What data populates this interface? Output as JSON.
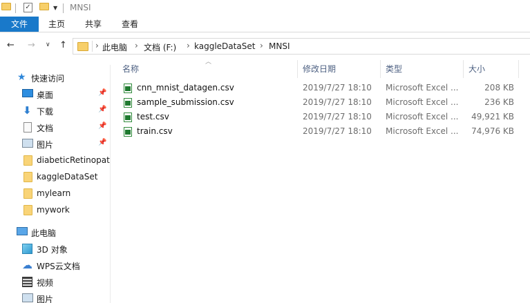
{
  "window": {
    "title": "MNSI"
  },
  "ribbon": {
    "tabs": [
      "文件",
      "主页",
      "共享",
      "查看"
    ]
  },
  "address": {
    "breadcrumb": [
      "此电脑",
      "文档 (F:)",
      "kaggleDataSet",
      "MNSI"
    ]
  },
  "sidebar": {
    "quick_access": "快速访问",
    "pinned": [
      "桌面",
      "下载",
      "文档",
      "图片"
    ],
    "folders": [
      "diabeticRetinopat",
      "kaggleDataSet",
      "mylearn",
      "mywork"
    ],
    "this_pc": "此电脑",
    "pc_items": [
      "3D 对象",
      "WPS云文档",
      "视频",
      "图片"
    ]
  },
  "columns": {
    "name": "名称",
    "date": "修改日期",
    "type": "类型",
    "size": "大小"
  },
  "files": [
    {
      "name": "cnn_mnist_datagen.csv",
      "date": "2019/7/27 18:10",
      "type": "Microsoft Excel ...",
      "size": "208 KB"
    },
    {
      "name": "sample_submission.csv",
      "date": "2019/7/27 18:10",
      "type": "Microsoft Excel ...",
      "size": "236 KB"
    },
    {
      "name": "test.csv",
      "date": "2019/7/27 18:10",
      "type": "Microsoft Excel ...",
      "size": "49,921 KB"
    },
    {
      "name": "train.csv",
      "date": "2019/7/27 18:10",
      "type": "Microsoft Excel ...",
      "size": "74,976 KB"
    }
  ],
  "icons": {
    "quick_access": "star-icon",
    "file": "excel-csv-icon",
    "folder": "folder-icon"
  },
  "colors": {
    "file_tab": "#1979ca",
    "header_text": "#4d6082"
  }
}
